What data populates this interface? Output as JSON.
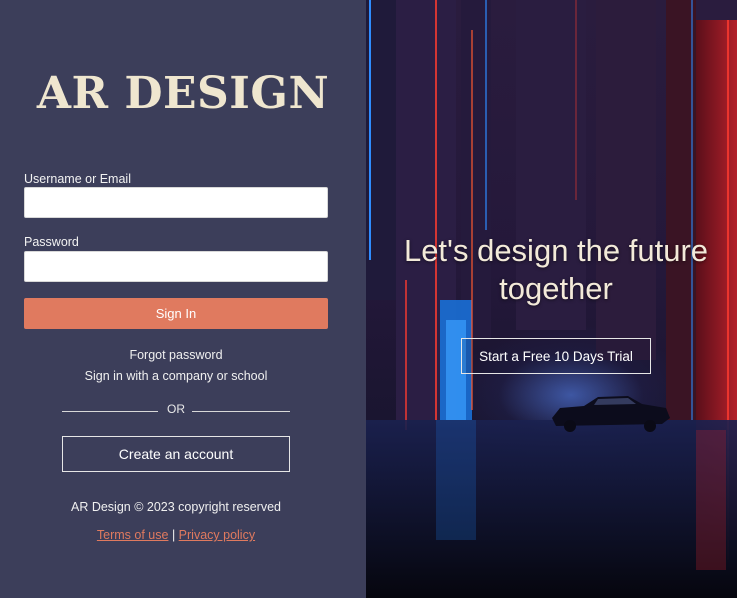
{
  "brand": {
    "title": "AR DESIGN"
  },
  "login": {
    "username_label": "Username or Email",
    "username_value": "",
    "password_label": "Password",
    "password_value": "",
    "signin_label": "Sign In",
    "forgot_password": "Forgot password",
    "sso_link": "Sign in with a company or school",
    "or_text": "OR",
    "create_account": "Create an account"
  },
  "footer": {
    "copyright": "AR Design © 2023 copyright reserved",
    "terms": "Terms of use",
    "separator": "|",
    "privacy": "Privacy policy"
  },
  "hero": {
    "title_line1": "Let's design the future",
    "title_line2": "together",
    "trial_button": "Start a Free 10 Days Trial"
  },
  "colors": {
    "panel_bg": "#3c3e5a",
    "brand_text": "#efe6cf",
    "accent": "#e07a5f",
    "neon_blue": "#2f8cff",
    "neon_red": "#ff3b2f"
  }
}
